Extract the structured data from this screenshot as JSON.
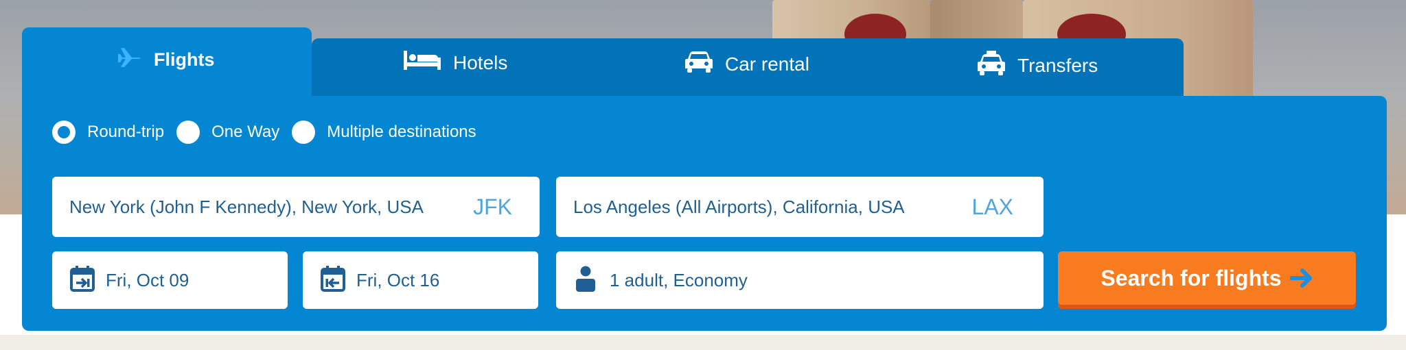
{
  "tabs": [
    {
      "label": "Flights",
      "icon": "plane-icon",
      "active": true
    },
    {
      "label": "Hotels",
      "icon": "bed-icon",
      "active": false
    },
    {
      "label": "Car rental",
      "icon": "car-icon",
      "active": false
    },
    {
      "label": "Transfers",
      "icon": "taxi-icon",
      "active": false
    }
  ],
  "trip_types": [
    {
      "label": "Round-trip",
      "selected": true
    },
    {
      "label": "One Way",
      "selected": false
    },
    {
      "label": "Multiple destinations",
      "selected": false
    }
  ],
  "origin": {
    "city": "New York (John F Kennedy), New York, USA",
    "code": "JFK"
  },
  "destination": {
    "city": "Los Angeles (All Airports), California, USA",
    "code": "LAX"
  },
  "dates": {
    "departure": {
      "value": "Fri, Oct 09",
      "icon": "calendar-departure-icon"
    },
    "return": {
      "value": "Fri, Oct 16",
      "icon": "calendar-return-icon"
    }
  },
  "passengers": {
    "value": "1 adult, Economy",
    "icon": "person-icon"
  },
  "search": {
    "label": "Search for flights",
    "icon": "arrow-right-icon"
  },
  "colors": {
    "panel": "#0586d3",
    "tab_bar": "#0373b9",
    "field_text": "#1f5f93",
    "airport_code": "#4ea6dd",
    "search_button": "#f97b1f"
  }
}
